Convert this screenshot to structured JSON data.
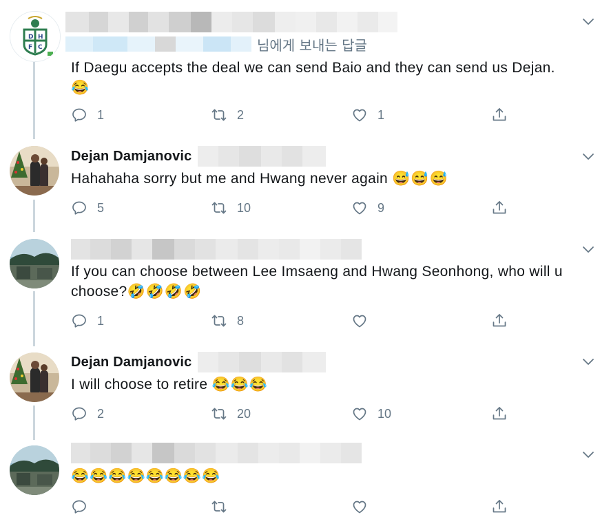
{
  "colors": {
    "accent": "#1da1f2",
    "icon": "#657786",
    "thread": "#ccd6dd",
    "text": "#14171a"
  },
  "tweets": [
    {
      "author": "",
      "reply_label": "님에게 보내는 답글",
      "text": "If Daegu accepts the deal we can send Baio and they can send us Dejan.",
      "emoji": "😂",
      "replies": "1",
      "retweets": "2",
      "likes": "1"
    },
    {
      "author": "Dejan Damjanovic",
      "text": "Hahahaha sorry but me and Hwang never again ",
      "emoji": "😅😅😅",
      "replies": "5",
      "retweets": "10",
      "likes": "9"
    },
    {
      "author": "",
      "text": "If you can choose between Lee Imsaeng and Hwang Seonhong, who will u choose?",
      "emoji": "🤣🤣🤣🤣",
      "replies": "1",
      "retweets": "8",
      "likes": ""
    },
    {
      "author": "Dejan Damjanovic",
      "text": "I will choose to retire ",
      "emoji": "😂😂😂",
      "replies": "2",
      "retweets": "20",
      "likes": "10"
    },
    {
      "author": "",
      "text": "",
      "emoji": "😂😂😂😂😂😂😂😂",
      "replies": "",
      "retweets": "",
      "likes": ""
    }
  ],
  "icons": [
    "reply-icon",
    "retweet-icon",
    "like-icon",
    "share-icon",
    "chevron-down-icon"
  ]
}
